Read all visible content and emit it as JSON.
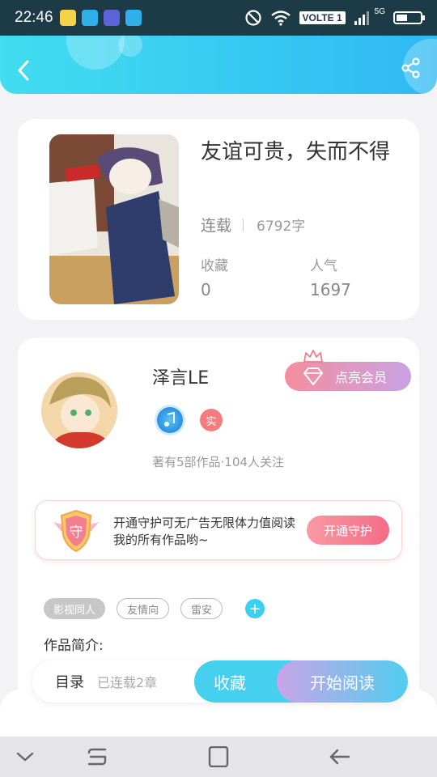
{
  "status_bar": {
    "time": "22:46",
    "network_label": "VOLTE 1",
    "network_type": "5G",
    "app_icons": [
      "emoji-app-icon",
      "shopping-bag-icon",
      "gallery-icon",
      "shopping-bag-icon"
    ]
  },
  "header": {
    "colors": [
      "#42ddf0",
      "#2fb9f3"
    ]
  },
  "book": {
    "title": "友谊可贵，失而不得",
    "status": "连载",
    "word_count": "6792字",
    "favorites_label": "收藏",
    "favorites_value": "0",
    "popularity_label": "人气",
    "popularity_value": "1697"
  },
  "author": {
    "name": "泽言LE",
    "vip_button": "点亮会员",
    "badge_real": "实",
    "stats": "著有5部作品·104人关注"
  },
  "guard": {
    "icon_char": "守",
    "text": "开通守护可无广告无限体力值阅读我的所有作品哟~",
    "button": "开通守护"
  },
  "tags": {
    "items": [
      "影视同人",
      "友情向",
      "雷安"
    ],
    "add_symbol": "+"
  },
  "intro_label": "作品简介:",
  "actions": {
    "toc": "目录",
    "chapters": "已连载2章",
    "favorite": "收藏",
    "start_reading": "开始阅读"
  }
}
